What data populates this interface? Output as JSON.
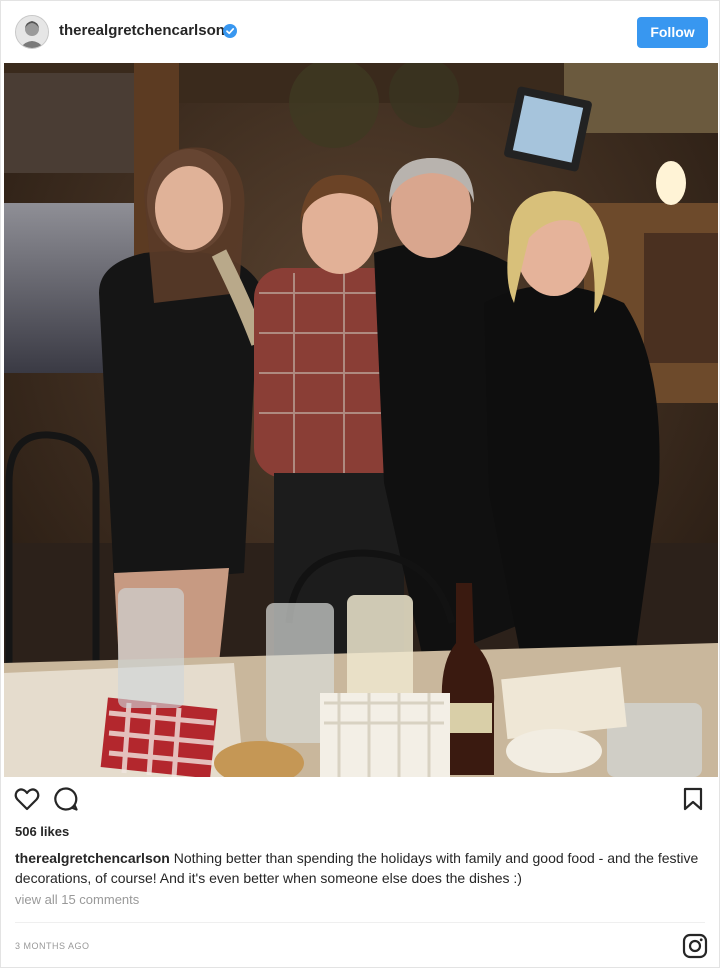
{
  "post": {
    "username": "therealgretchencarlson",
    "follow_label": "Follow",
    "likes": "506 likes",
    "caption_user": "therealgretchencarlson",
    "caption_text": " Nothing better than spending the holidays with family and good food - and the festive decorations, of course! And it's even better when someone else does the dishes :)",
    "view_comments": "view all 15 comments",
    "timestamp": "3 MONTHS AGO"
  },
  "icons": {
    "verified": "verified-badge-icon",
    "like": "heart-icon",
    "comment": "comment-icon",
    "save": "bookmark-icon",
    "brand": "instagram-icon"
  },
  "colors": {
    "accent": "#3897f0",
    "text": "#262626",
    "muted": "#999999"
  }
}
